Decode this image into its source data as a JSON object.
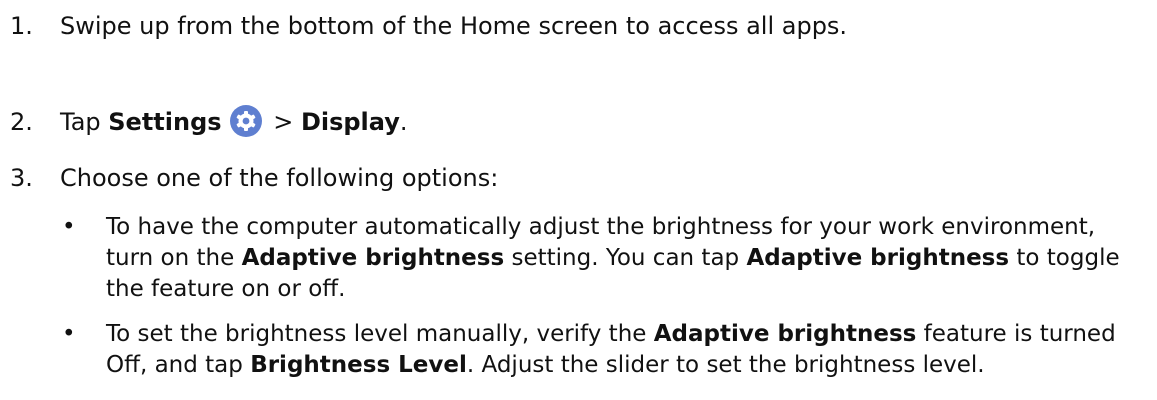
{
  "steps": [
    {
      "num": "1.",
      "text": "Swipe up from the bottom of the Home screen to access all apps."
    },
    {
      "num": "2.",
      "text_a": "Tap ",
      "bold_a": "Settings",
      "sep": " > ",
      "bold_b": "Display",
      "text_end": "."
    },
    {
      "num": "3.",
      "text": "Choose one of the following options:"
    }
  ],
  "bullets": [
    {
      "mark": "•",
      "t1": "To have the computer automatically adjust the brightness for your work environment, turn on the ",
      "b1": "Adaptive brightness",
      "t2": " setting. You can tap ",
      "b2": "Adaptive brightness",
      "t3": " to toggle the feature on or off."
    },
    {
      "mark": "•",
      "t1": "To set the brightness level manually, verify the ",
      "b1": "Adaptive brightness",
      "t2": " feature is turned Off, and tap ",
      "b2": "Brightness Level",
      "t3": ". Adjust the slider to set the brightness level."
    }
  ],
  "icons": {
    "settings": "gear-icon"
  },
  "colors": {
    "text": "#111111",
    "settings_icon_bg": "#5f7fd0",
    "settings_icon_fg": "#ffffff"
  }
}
